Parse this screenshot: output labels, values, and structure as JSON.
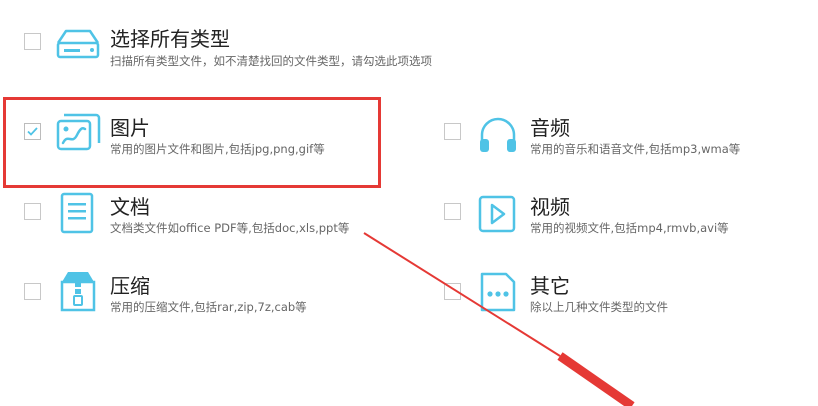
{
  "options": [
    {
      "key": "all",
      "title": "选择所有类型",
      "desc": "扫描所有类型文件，如不清楚找回的文件类型，请勾选此项选项",
      "checked": false,
      "icon": "hard-drive-icon"
    },
    {
      "key": "images",
      "title": "图片",
      "desc": "常用的图片文件和图片,包括jpg,png,gif等",
      "checked": true,
      "icon": "image-icon"
    },
    {
      "key": "audio",
      "title": "音频",
      "desc": "常用的音乐和语音文件,包括mp3,wma等",
      "checked": false,
      "icon": "headphones-icon"
    },
    {
      "key": "docs",
      "title": "文档",
      "desc": "文档类文件如office PDF等,包括doc,xls,ppt等",
      "checked": false,
      "icon": "document-icon"
    },
    {
      "key": "video",
      "title": "视频",
      "desc": "常用的视频文件,包括mp4,rmvb,avi等",
      "checked": false,
      "icon": "video-icon"
    },
    {
      "key": "archive",
      "title": "压缩",
      "desc": "常用的压缩文件,包括rar,zip,7z,cab等",
      "checked": false,
      "icon": "archive-icon"
    },
    {
      "key": "other",
      "title": "其它",
      "desc": "除以上几种文件类型的文件",
      "checked": false,
      "icon": "more-dots-icon"
    }
  ],
  "colors": {
    "accent": "#4fc3e6",
    "highlight": "#e53935",
    "check": "#4fc3e6"
  }
}
